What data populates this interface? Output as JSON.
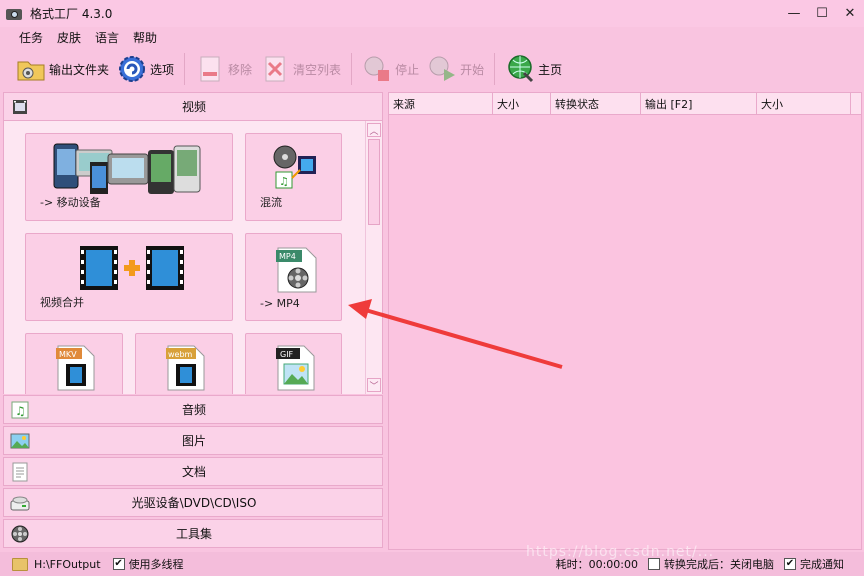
{
  "window": {
    "title": "格式工厂 4.3.0",
    "minimize": "—",
    "maximize": "☐",
    "close": "✕"
  },
  "menu": [
    "任务",
    "皮肤",
    "语言",
    "帮助"
  ],
  "toolbar": {
    "output_folder": "输出文件夹",
    "options": "选项",
    "remove": "移除",
    "clear_list": "清空列表",
    "stop": "停止",
    "start": "开始",
    "home": "主页"
  },
  "categories": {
    "video": "视频",
    "audio": "音频",
    "picture": "图片",
    "document": "文档",
    "rom": "光驱设备\\DVD\\CD\\ISO",
    "tools": "工具集"
  },
  "video_tiles": {
    "mobile": "-> 移动设备",
    "mux": "混流",
    "join": "视频合并",
    "mp4": "-> MP4",
    "mkv_badge": "MKV",
    "webm_badge": "webm",
    "gif_badge": "GIF",
    "mp4_badge": "MP4"
  },
  "scroll": {
    "up": "︿",
    "down": "﹀"
  },
  "grid_columns": [
    "来源",
    "大小",
    "转换状态",
    "输出 [F2]",
    "大小"
  ],
  "status": {
    "path": "H:\\FFOutput",
    "multithread": "使用多线程",
    "elapsed": "耗时：00:00:00",
    "after_done": "转换完成后：关闭电脑",
    "notify": "完成通知",
    "check": "✔"
  },
  "watermark": "https://blog.csdn.net/...",
  "colors": {
    "accent": "#f03a3a",
    "skin": "#f9c4e0"
  }
}
